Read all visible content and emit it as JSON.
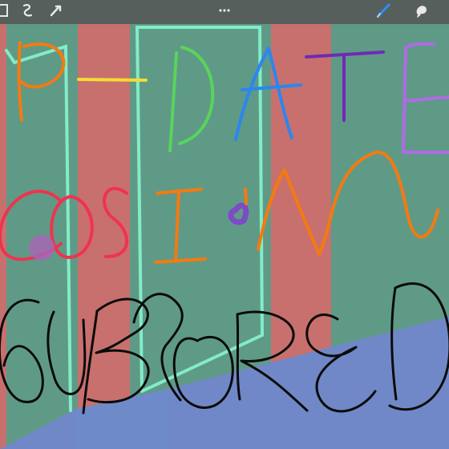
{
  "toolbar": {
    "icons": {
      "gallery": "gallery-icon",
      "adjustments": "adjustments-icon",
      "selection": "selection-icon",
      "transform": "transform-icon",
      "more": "more-icon",
      "brush": "brush-icon",
      "smudge": "smudge-icon"
    }
  },
  "canvas": {
    "colors": {
      "wall_green": "#5f9a87",
      "column_red": "#c8706d",
      "floor_blue": "#7088c7",
      "door_frame": "#82ecc8",
      "orange_ink": "#f37a12",
      "yellow_ink": "#f4dc35",
      "green_ink": "#58d45b",
      "blue_ink": "#2b86f0",
      "purple_ink": "#6f2ab6",
      "violet_ink": "#b06ae6",
      "red_ink": "#ef334f",
      "black_ink": "#0b0b0b"
    }
  }
}
